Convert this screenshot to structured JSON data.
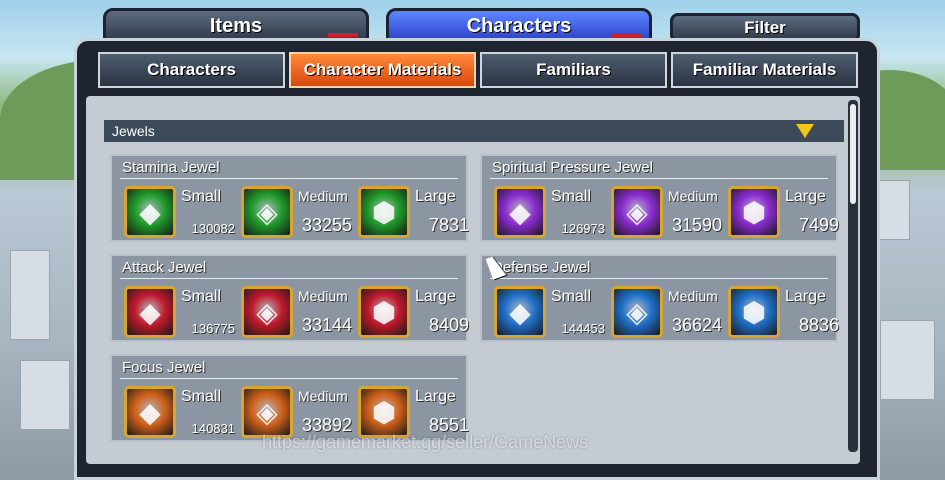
{
  "top_tabs": {
    "items": "Items",
    "characters": "Characters",
    "filter": "Filter"
  },
  "sub_tabs": [
    {
      "label": "Characters",
      "active": false
    },
    {
      "label": "Character Materials",
      "active": true
    },
    {
      "label": "Familiars",
      "active": false
    },
    {
      "label": "Familiar Materials",
      "active": false
    }
  ],
  "section": {
    "title": "Jewels"
  },
  "cards": [
    {
      "title": "Stamina Jewel",
      "color": "#1f9b2a",
      "items": [
        {
          "size": "Small",
          "count": "130082"
        },
        {
          "size": "Medium",
          "count": "33255"
        },
        {
          "size": "Large",
          "count": "7831"
        }
      ]
    },
    {
      "title": "Spiritual Pressure Jewel",
      "color": "#8a2bd0",
      "items": [
        {
          "size": "Small",
          "count": "126973"
        },
        {
          "size": "Medium",
          "count": "31590"
        },
        {
          "size": "Large",
          "count": "7499"
        }
      ]
    },
    {
      "title": "Attack Jewel",
      "color": "#c0192a",
      "items": [
        {
          "size": "Small",
          "count": "136775"
        },
        {
          "size": "Medium",
          "count": "33144"
        },
        {
          "size": "Large",
          "count": "8409"
        }
      ]
    },
    {
      "title": "Defense Jewel",
      "color": "#1e6fc8",
      "items": [
        {
          "size": "Small",
          "count": "144453"
        },
        {
          "size": "Medium",
          "count": "36624"
        },
        {
          "size": "Large",
          "count": "8836"
        }
      ]
    },
    {
      "title": "Focus Jewel",
      "color": "#d0601a",
      "items": [
        {
          "size": "Small",
          "count": "140831"
        },
        {
          "size": "Medium",
          "count": "33892"
        },
        {
          "size": "Large",
          "count": "8551"
        }
      ]
    }
  ],
  "watermark": "https://gamemarket.gg/seller/GameNews"
}
